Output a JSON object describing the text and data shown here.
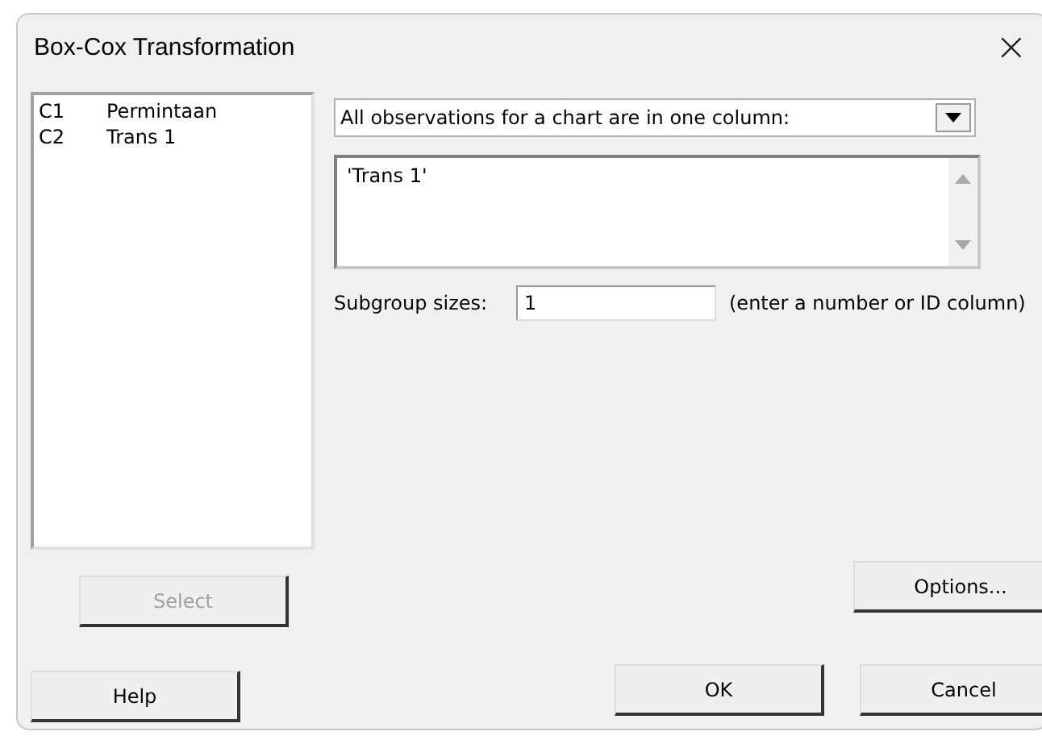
{
  "window": {
    "title": "Box-Cox Transformation",
    "close": "×"
  },
  "variables": [
    {
      "column": "C1",
      "name": "Permintaan",
      "selected": false
    },
    {
      "column": "C2",
      "name": "Trans 1",
      "selected": false
    }
  ],
  "select_button": {
    "label": "Select",
    "disabled": true
  },
  "layout_dropdown": {
    "value": "All observations for a chart are in one column:"
  },
  "columns_box": {
    "value": "'Trans 1'"
  },
  "subgroup": {
    "label": "Subgroup sizes:",
    "value": "1",
    "hint": "(enter a number or ID column)"
  },
  "buttons": [
    {
      "kind": "options",
      "label": "Options..."
    },
    {
      "kind": "help",
      "label": "Help"
    },
    {
      "kind": "ok",
      "label": "OK"
    },
    {
      "kind": "cancel",
      "label": "Cancel"
    }
  ]
}
